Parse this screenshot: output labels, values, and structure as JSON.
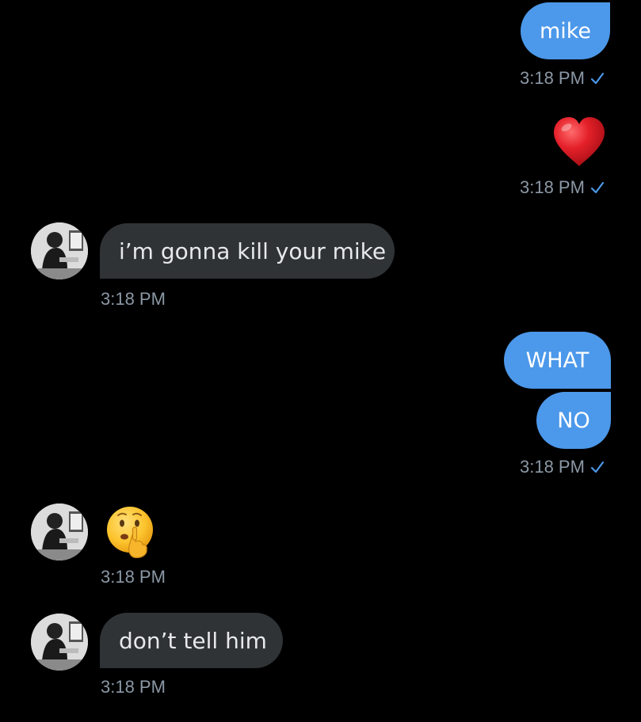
{
  "colors": {
    "background": "#000000",
    "outgoing_bubble": "#4C98EA",
    "incoming_bubble": "#2F3336",
    "timestamp": "#8B98A5",
    "read_check": "#4C98EA"
  },
  "messages": [
    {
      "direction": "outgoing",
      "text": "mike",
      "timestamp": "3:18 PM",
      "read": true
    },
    {
      "direction": "outgoing",
      "emoji": "red-heart",
      "timestamp": "3:18 PM",
      "read": true
    },
    {
      "direction": "incoming",
      "text": "i’m gonna kill your mike",
      "timestamp": "3:18 PM"
    },
    {
      "direction": "outgoing",
      "text": "WHAT"
    },
    {
      "direction": "outgoing",
      "text": "NO",
      "timestamp": "3:18 PM",
      "read": true
    },
    {
      "direction": "incoming",
      "emoji": "shushing-face",
      "timestamp": "3:18 PM"
    },
    {
      "direction": "incoming",
      "text": "don’t tell him",
      "timestamp": "3:18 PM"
    }
  ]
}
